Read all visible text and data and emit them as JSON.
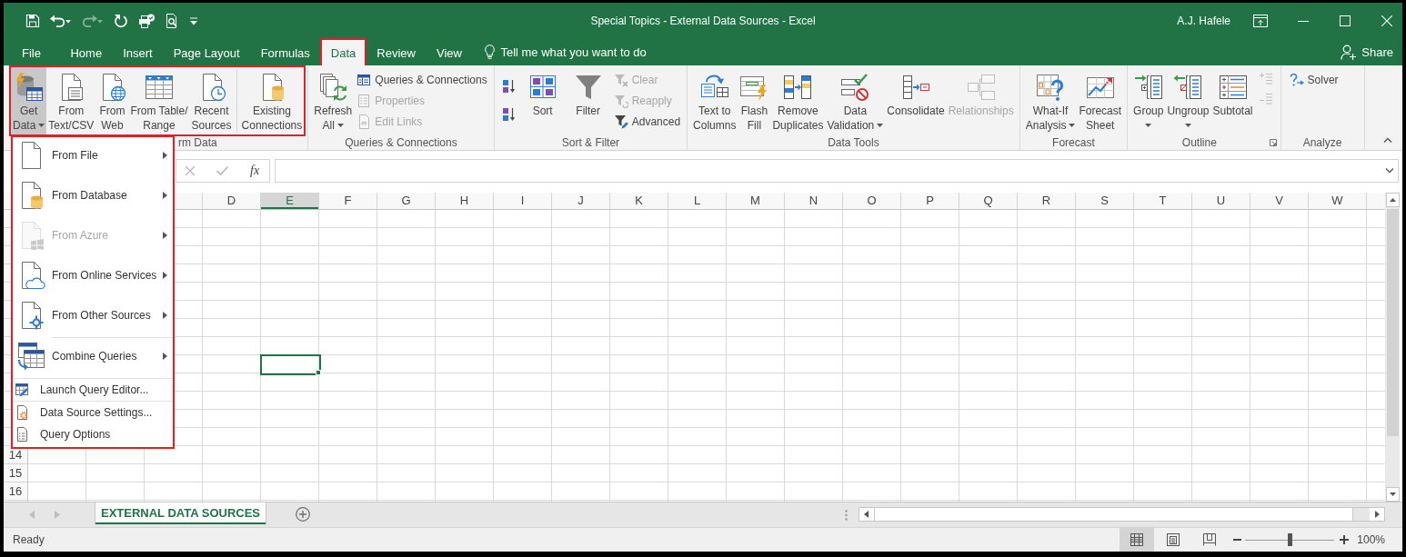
{
  "title_bar": {
    "quick_access": [
      {
        "kind": "save",
        "disabled": false
      },
      {
        "kind": "undo",
        "disabled": false
      },
      {
        "kind": "redo",
        "disabled": true
      },
      {
        "kind": "repeat",
        "disabled": false
      },
      {
        "kind": "touch",
        "disabled": false
      },
      {
        "kind": "preview",
        "disabled": false
      },
      {
        "kind": "customize",
        "disabled": false
      }
    ],
    "title": "Special Topics - External Data Sources - Excel",
    "user": "A.J. Hafele"
  },
  "tabs": [
    {
      "label": "File",
      "selected": false,
      "highlighted": false
    },
    {
      "label": "Home",
      "selected": false,
      "highlighted": false
    },
    {
      "label": "Insert",
      "selected": false,
      "highlighted": false
    },
    {
      "label": "Page Layout",
      "selected": false,
      "highlighted": false
    },
    {
      "label": "Formulas",
      "selected": false,
      "highlighted": false
    },
    {
      "label": "Data",
      "selected": true,
      "highlighted": true
    },
    {
      "label": "Review",
      "selected": false,
      "highlighted": false
    },
    {
      "label": "View",
      "selected": false,
      "highlighted": false
    }
  ],
  "tell_me": {
    "placeholder": "Tell me what you want to do"
  },
  "share": {
    "label": "Share"
  },
  "ribbon": {
    "groups": [
      {
        "label": "rm Data",
        "highlighted": true,
        "launcher": false,
        "controls": [
          {
            "kind": "getdata",
            "lines": [
              "Get",
              "Data"
            ],
            "dropdown": true,
            "pressed": true,
            "disabled": false
          },
          {
            "kind": "textcsv",
            "lines": [
              "From",
              "Text/CSV"
            ],
            "dropdown": false,
            "pressed": false,
            "disabled": false
          },
          {
            "kind": "web",
            "lines": [
              "From",
              "Web"
            ],
            "dropdown": false,
            "pressed": false,
            "disabled": false
          },
          {
            "kind": "table",
            "lines": [
              "From Table/",
              "Range"
            ],
            "dropdown": false,
            "pressed": false,
            "disabled": false
          },
          {
            "kind": "recent",
            "lines": [
              "Recent",
              "Sources"
            ],
            "dropdown": false,
            "pressed": false,
            "disabled": false
          },
          {
            "kind": "connections",
            "lines": [
              "Existing",
              "Connections"
            ],
            "dropdown": false,
            "pressed": false,
            "disabled": false
          }
        ]
      },
      {
        "label": "Queries & Connections",
        "highlighted": false,
        "launcher": false,
        "controls": [
          {
            "kind": "refresh",
            "lines": [
              "Refresh",
              "All"
            ],
            "dropdown": true,
            "pressed": false,
            "disabled": false
          },
          {
            "kind": "queries",
            "label": "Queries & Connections",
            "disabled": false
          },
          {
            "kind": "properties",
            "label": "Properties",
            "disabled": true
          },
          {
            "kind": "editlinks",
            "label": "Edit Links",
            "disabled": true
          }
        ]
      },
      {
        "label": "Sort & Filter",
        "highlighted": false,
        "launcher": false,
        "controls": [
          {
            "kind": "sortaz",
            "disabled": false
          },
          {
            "kind": "sortza",
            "disabled": false
          },
          {
            "kind": "sort",
            "lines": [
              "Sort"
            ],
            "dropdown": false,
            "pressed": false,
            "disabled": false
          },
          {
            "kind": "filter",
            "lines": [
              "Filter"
            ],
            "dropdown": false,
            "pressed": false,
            "disabled": false
          },
          {
            "kind": "clear",
            "label": "Clear",
            "disabled": true
          },
          {
            "kind": "reapply",
            "label": "Reapply",
            "disabled": true
          },
          {
            "kind": "advanced",
            "label": "Advanced",
            "disabled": false
          }
        ]
      },
      {
        "label": "Data Tools",
        "highlighted": false,
        "launcher": false,
        "controls": [
          {
            "kind": "texttocolumns",
            "lines": [
              "Text to",
              "Columns"
            ],
            "dropdown": false,
            "pressed": false,
            "disabled": false
          },
          {
            "kind": "flashfill",
            "lines": [
              "Flash",
              "Fill"
            ],
            "dropdown": false,
            "pressed": false,
            "disabled": false
          },
          {
            "kind": "removeduplicates",
            "lines": [
              "Remove",
              "Duplicates"
            ],
            "dropdown": false,
            "pressed": false,
            "disabled": false
          },
          {
            "kind": "validation",
            "lines": [
              "Data",
              "Validation"
            ],
            "dropdown": true,
            "pressed": false,
            "disabled": false
          },
          {
            "kind": "consolidate",
            "lines": [
              "Consolidate"
            ],
            "dropdown": false,
            "pressed": false,
            "disabled": false
          },
          {
            "kind": "relationships",
            "lines": [
              "Relationships"
            ],
            "dropdown": false,
            "pressed": false,
            "disabled": true
          }
        ]
      },
      {
        "label": "Forecast",
        "highlighted": false,
        "launcher": false,
        "controls": [
          {
            "kind": "whatif",
            "lines": [
              "What-If",
              "Analysis"
            ],
            "dropdown": true,
            "pressed": false,
            "disabled": false
          },
          {
            "kind": "forecast",
            "lines": [
              "Forecast",
              "Sheet"
            ],
            "dropdown": false,
            "pressed": false,
            "disabled": false
          }
        ]
      },
      {
        "label": "Outline",
        "highlighted": false,
        "launcher": true,
        "controls": [
          {
            "kind": "group",
            "lines": [
              "Group"
            ],
            "dropdown": true,
            "pressed": false,
            "disabled": false
          },
          {
            "kind": "ungroup",
            "lines": [
              "Ungroup"
            ],
            "dropdown": true,
            "pressed": false,
            "disabled": false
          },
          {
            "kind": "subtotal",
            "lines": [
              "Subtotal"
            ],
            "dropdown": false,
            "pressed": false,
            "disabled": false
          },
          {
            "kind": "showdetail",
            "disabled": true
          },
          {
            "kind": "hidedetail",
            "disabled": true
          }
        ]
      },
      {
        "label": "Analyze",
        "highlighted": false,
        "launcher": false,
        "controls": [
          {
            "kind": "solver",
            "label": "Solver",
            "disabled": false
          }
        ]
      }
    ]
  },
  "get_data_menu": {
    "highlighted": true,
    "sections": [
      [
        {
          "kind": "file",
          "label": "From File",
          "submenu": true,
          "disabled": false
        },
        {
          "kind": "database",
          "label": "From Database",
          "submenu": true,
          "disabled": false
        },
        {
          "kind": "azure",
          "label": "From Azure",
          "submenu": true,
          "disabled": true
        },
        {
          "kind": "online",
          "label": "From Online Services",
          "submenu": true,
          "disabled": false
        },
        {
          "kind": "other",
          "label": "From Other Sources",
          "submenu": true,
          "disabled": false
        }
      ],
      [
        {
          "kind": "combine",
          "label": "Combine Queries",
          "submenu": true,
          "disabled": false
        }
      ],
      [
        {
          "kind": "editor",
          "label": "Launch Query Editor...",
          "submenu": false,
          "disabled": false
        }
      ],
      [
        {
          "kind": "settings",
          "label": "Data Source Settings...",
          "submenu": false,
          "disabled": false
        },
        {
          "kind": "options",
          "label": "Query Options",
          "submenu": false,
          "disabled": false
        }
      ]
    ]
  },
  "formula_bar": {
    "cancel": {
      "disabled": true
    },
    "enter": {
      "disabled": true
    },
    "function_label": "fx"
  },
  "grid": {
    "columns": [
      {},
      {},
      {},
      {
        "label": "D",
        "selected": false
      },
      {
        "label": "E",
        "selected": true
      },
      {
        "label": "F",
        "selected": false
      },
      {
        "label": "G",
        "selected": false
      },
      {
        "label": "H",
        "selected": false
      },
      {
        "label": "I",
        "selected": false
      },
      {
        "label": "J",
        "selected": false
      },
      {
        "label": "K",
        "selected": false
      },
      {
        "label": "L",
        "selected": false
      },
      {
        "label": "M",
        "selected": false
      },
      {
        "label": "N",
        "selected": false
      },
      {
        "label": "O",
        "selected": false
      },
      {
        "label": "P",
        "selected": false
      },
      {
        "label": "Q",
        "selected": false
      },
      {
        "label": "R",
        "selected": false
      },
      {
        "label": "S",
        "selected": false
      },
      {
        "label": "T",
        "selected": false
      },
      {
        "label": "U",
        "selected": false
      },
      {
        "label": "V",
        "selected": false
      },
      {
        "label": "W",
        "selected": false
      }
    ],
    "rows": [
      {},
      {},
      {},
      {},
      {},
      {},
      {},
      {},
      {
        "selected": true
      },
      {},
      {},
      {},
      {},
      {
        "label": "14",
        "selected": false
      },
      {
        "label": "15",
        "selected": false
      },
      {
        "label": "16",
        "selected": false
      }
    ]
  },
  "sheet_tabs": [
    {
      "label": "EXTERNAL DATA SOURCES",
      "selected": true
    }
  ],
  "status_bar": {
    "text": "Ready",
    "views": [
      {
        "kind": "normal",
        "selected": true
      },
      {
        "kind": "pagelayout",
        "selected": false
      },
      {
        "kind": "pagebreak",
        "selected": false
      }
    ],
    "zoom": {
      "level": 0.5,
      "reading": "100%"
    }
  }
}
